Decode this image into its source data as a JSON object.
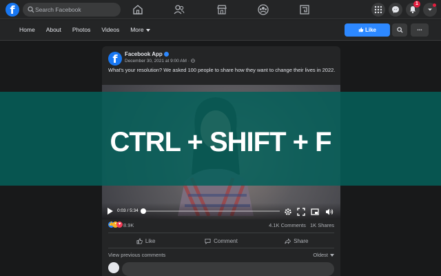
{
  "topbar": {
    "logo": "f",
    "search_placeholder": "Search Facebook",
    "nav_icons": [
      "home-icon",
      "friends-icon",
      "marketplace-icon",
      "groups-icon",
      "gaming-icon"
    ],
    "notification_count": "1"
  },
  "page_nav": {
    "tabs": [
      "Home",
      "About",
      "Photos",
      "Videos",
      "More"
    ],
    "like_label": "Like",
    "more_label": "..."
  },
  "post": {
    "avatar_letter": "f",
    "author": "Facebook App",
    "date": "December 30, 2021 at 9:00 AM ·",
    "text": "What's your resolution? We asked 100 people to share how they want to change their lives in 2022.",
    "video": {
      "time": "0:03 / 5:34",
      "progress": 0.01
    },
    "reaction_count": "8.9K",
    "comments_count": "4.1K Comments",
    "shares_count": "1K Shares",
    "actions": [
      "Like",
      "Comment",
      "Share"
    ],
    "view_previous": "View previous comments",
    "sort_label": "Oldest"
  },
  "overlay": {
    "shortcut": "CTRL + SHIFT + F"
  },
  "colors": {
    "accent": "#2d88ff",
    "overlay_band": "#055f5a",
    "background": "#18191a",
    "surface": "#242526"
  }
}
